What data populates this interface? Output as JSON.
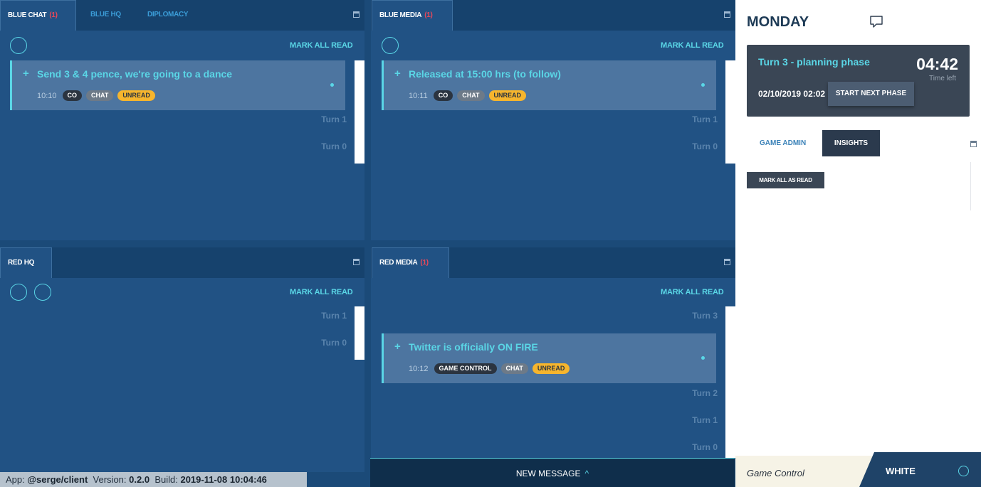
{
  "panels": {
    "blue_chat": {
      "tabs": [
        {
          "label": "BLUE CHAT",
          "count": "(1)"
        },
        {
          "label": "BLUE HQ"
        },
        {
          "label": "DIPLOMACY"
        }
      ],
      "mark_all_read": "MARK ALL READ",
      "message": {
        "title": "Send 3 & 4 pence, we're going to a dance",
        "time": "10:10",
        "badges": [
          "CO",
          "CHAT",
          "UNREAD"
        ]
      },
      "turns": [
        "Turn 1",
        "Turn 0"
      ]
    },
    "blue_media": {
      "tabs": [
        {
          "label": "BLUE MEDIA",
          "count": "(1)"
        }
      ],
      "mark_all_read": "MARK ALL READ",
      "message": {
        "title": "Released at 15:00 hrs (to follow)",
        "time": "10:11",
        "badges": [
          "CO",
          "CHAT",
          "UNREAD"
        ]
      },
      "turns": [
        "Turn 1",
        "Turn 0"
      ]
    },
    "red_hq": {
      "tabs": [
        {
          "label": "RED HQ"
        }
      ],
      "mark_all_read": "MARK ALL READ",
      "turns": [
        "Turn 1",
        "Turn 0"
      ]
    },
    "red_media": {
      "tabs": [
        {
          "label": "RED MEDIA",
          "count": "(1)"
        }
      ],
      "mark_all_read": "MARK ALL READ",
      "message": {
        "title": "Twitter is officially ON FIRE",
        "time": "10:12",
        "badges": [
          "GAME CONTROL",
          "CHAT",
          "UNREAD"
        ]
      },
      "turns": [
        "Turn 3",
        "Turn 2",
        "Turn 1",
        "Turn 0"
      ]
    }
  },
  "sidebar": {
    "day": "MONDAY",
    "phase_title": "Turn 3 - planning phase",
    "time_left_value": "04:42",
    "time_left_label": "Time left",
    "date": "02/10/2019 02:02",
    "start_next_phase": "START NEXT PHASE",
    "tabs": [
      "GAME ADMIN",
      "INSIGHTS"
    ],
    "mark_all_as_read": "MARK ALL AS READ"
  },
  "footer": {
    "new_message": "NEW MESSAGE",
    "new_message_chevron": "^",
    "force_name": "Game Control",
    "role": "WHITE",
    "app_label": "App:",
    "app_value": "@serge/client",
    "version_label": "Version:",
    "version_value": "0.2.0",
    "build_label": "Build:",
    "build_value": "2019-11-08 10:04:46"
  },
  "colors": {
    "accent": "#5ad6e6",
    "panel": "#215284",
    "unread": "#f6b52d",
    "count": "#e8485a"
  }
}
